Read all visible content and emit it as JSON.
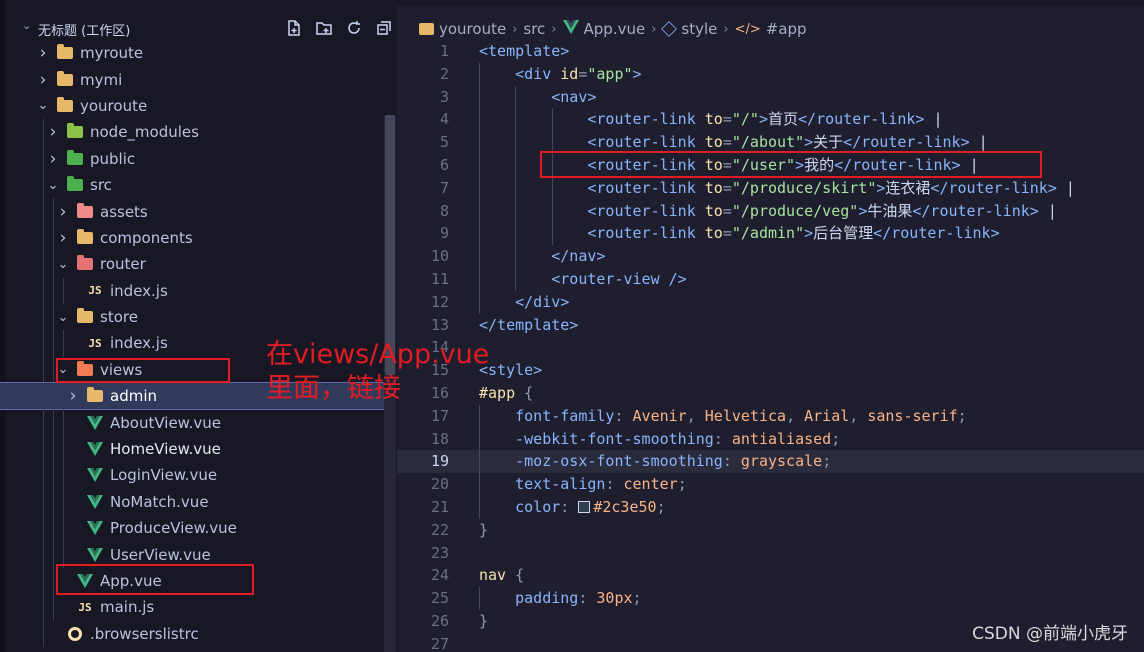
{
  "explorer": {
    "workspace_title": "无标题 (工作区)",
    "actions": [
      "new-file-icon",
      "new-folder-icon",
      "refresh-icon",
      "collapse-all-icon"
    ],
    "items": [
      {
        "label": "myroute",
        "kind": "folder",
        "depth": 0,
        "state": "collapsed",
        "icon_color": "#e8b86a"
      },
      {
        "label": "mymi",
        "kind": "folder",
        "depth": 0,
        "state": "collapsed",
        "icon_color": "#e8b86a"
      },
      {
        "label": "youroute",
        "kind": "folder",
        "depth": 0,
        "state": "expanded",
        "icon_color": "#e8b86a"
      },
      {
        "label": "node_modules",
        "kind": "folder",
        "depth": 1,
        "state": "collapsed",
        "icon_color": "#8bc34a"
      },
      {
        "label": "public",
        "kind": "folder",
        "depth": 1,
        "state": "collapsed",
        "icon_color": "#4caf50"
      },
      {
        "label": "src",
        "kind": "folder",
        "depth": 1,
        "state": "expanded",
        "icon_color": "#4caf50"
      },
      {
        "label": "assets",
        "kind": "folder",
        "depth": 2,
        "state": "collapsed",
        "icon_color": "#ef8a8a"
      },
      {
        "label": "components",
        "kind": "folder",
        "depth": 2,
        "state": "collapsed",
        "icon_color": "#e8b86a"
      },
      {
        "label": "router",
        "kind": "folder",
        "depth": 2,
        "state": "expanded",
        "icon_color": "#e57373"
      },
      {
        "label": "index.js",
        "kind": "js",
        "depth": 3
      },
      {
        "label": "store",
        "kind": "folder",
        "depth": 2,
        "state": "expanded",
        "icon_color": "#e8b86a"
      },
      {
        "label": "index.js",
        "kind": "js",
        "depth": 3
      },
      {
        "label": "views",
        "kind": "folder",
        "depth": 2,
        "state": "expanded",
        "icon_color": "#f57c52"
      },
      {
        "label": "admin",
        "kind": "folder",
        "depth": 3,
        "state": "collapsed",
        "icon_color": "#e8b86a",
        "selected": true
      },
      {
        "label": "AboutView.vue",
        "kind": "vue",
        "depth": 3
      },
      {
        "label": "HomeView.vue",
        "kind": "vue",
        "depth": 3,
        "bright": true
      },
      {
        "label": "LoginView.vue",
        "kind": "vue",
        "depth": 3
      },
      {
        "label": "NoMatch.vue",
        "kind": "vue",
        "depth": 3
      },
      {
        "label": "ProduceView.vue",
        "kind": "vue",
        "depth": 3
      },
      {
        "label": "UserView.vue",
        "kind": "vue",
        "depth": 3
      },
      {
        "label": "App.vue",
        "kind": "vue",
        "depth": 2
      },
      {
        "label": "main.js",
        "kind": "js",
        "depth": 2
      },
      {
        "label": ".browserslistrc",
        "kind": "browserslist",
        "depth": 1
      }
    ]
  },
  "breadcrumb": [
    "youroute",
    "src",
    "App.vue",
    "style",
    "#app"
  ],
  "editor": {
    "active_line": 19,
    "lines": [
      {
        "n": "1",
        "indent": 0,
        "tokens": [
          [
            "tag",
            "<template>"
          ]
        ]
      },
      {
        "n": "2",
        "indent": 1,
        "tokens": [
          [
            "tag",
            "<div "
          ],
          [
            "attr",
            "id"
          ],
          [
            "pun",
            "="
          ],
          [
            "str",
            "\"app\""
          ],
          [
            "tag",
            ">"
          ]
        ]
      },
      {
        "n": "3",
        "indent": 2,
        "tokens": [
          [
            "tag",
            "<nav>"
          ]
        ]
      },
      {
        "n": "4",
        "indent": 3,
        "tokens": [
          [
            "tag",
            "<router-link "
          ],
          [
            "attr",
            "to"
          ],
          [
            "pun",
            "="
          ],
          [
            "str",
            "\"/\""
          ],
          [
            "tag",
            ">"
          ],
          [
            "txt",
            "首页"
          ],
          [
            "tag",
            "</router-link>"
          ],
          [
            "txt",
            " |"
          ]
        ]
      },
      {
        "n": "5",
        "indent": 3,
        "tokens": [
          [
            "tag",
            "<router-link "
          ],
          [
            "attr",
            "to"
          ],
          [
            "pun",
            "="
          ],
          [
            "str",
            "\"/about\""
          ],
          [
            "tag",
            ">"
          ],
          [
            "txt",
            "关于"
          ],
          [
            "tag",
            "</router-link>"
          ],
          [
            "txt",
            " |"
          ]
        ]
      },
      {
        "n": "6",
        "indent": 3,
        "tokens": [
          [
            "tag",
            "<router-link "
          ],
          [
            "attr",
            "to"
          ],
          [
            "pun",
            "="
          ],
          [
            "str",
            "\"/user\""
          ],
          [
            "tag",
            ">"
          ],
          [
            "txt",
            "我的"
          ],
          [
            "tag",
            "</router-link>"
          ],
          [
            "txt",
            " |"
          ]
        ]
      },
      {
        "n": "7",
        "indent": 3,
        "tokens": [
          [
            "tag",
            "<router-link "
          ],
          [
            "attr",
            "to"
          ],
          [
            "pun",
            "="
          ],
          [
            "str",
            "\"/produce/skirt\""
          ],
          [
            "tag",
            ">"
          ],
          [
            "txt",
            "连衣裙"
          ],
          [
            "tag",
            "</router-link>"
          ],
          [
            "txt",
            " |"
          ]
        ]
      },
      {
        "n": "8",
        "indent": 3,
        "tokens": [
          [
            "tag",
            "<router-link "
          ],
          [
            "attr",
            "to"
          ],
          [
            "pun",
            "="
          ],
          [
            "str",
            "\"/produce/veg\""
          ],
          [
            "tag",
            ">"
          ],
          [
            "txt",
            "牛油果"
          ],
          [
            "tag",
            "</router-link>"
          ],
          [
            "txt",
            " |"
          ]
        ]
      },
      {
        "n": "9",
        "indent": 3,
        "tokens": [
          [
            "tag",
            "<router-link "
          ],
          [
            "attr",
            "to"
          ],
          [
            "pun",
            "="
          ],
          [
            "str",
            "\"/admin\""
          ],
          [
            "tag",
            ">"
          ],
          [
            "txt",
            "后台管理"
          ],
          [
            "tag",
            "</router-link>"
          ]
        ]
      },
      {
        "n": "10",
        "indent": 2,
        "tokens": [
          [
            "tag",
            "</nav>"
          ]
        ]
      },
      {
        "n": "11",
        "indent": 2,
        "tokens": [
          [
            "tag",
            "<router-view />"
          ]
        ]
      },
      {
        "n": "12",
        "indent": 1,
        "tokens": [
          [
            "tag",
            "</div>"
          ]
        ]
      },
      {
        "n": "13",
        "indent": 0,
        "tokens": [
          [
            "tag",
            "</template>"
          ]
        ]
      },
      {
        "n": "14",
        "indent": 0,
        "tokens": []
      },
      {
        "n": "15",
        "indent": 0,
        "tokens": [
          [
            "tag",
            "<style>"
          ]
        ]
      },
      {
        "n": "16",
        "indent": 0,
        "tokens": [
          [
            "sel",
            "#app"
          ],
          [
            "pun",
            " {"
          ]
        ]
      },
      {
        "n": "17",
        "indent": 1,
        "tokens": [
          [
            "prop",
            "font-family"
          ],
          [
            "pun",
            ": "
          ],
          [
            "val",
            "Avenir"
          ],
          [
            "pun",
            ", "
          ],
          [
            "val",
            "Helvetica"
          ],
          [
            "pun",
            ", "
          ],
          [
            "val",
            "Arial"
          ],
          [
            "pun",
            ", "
          ],
          [
            "val",
            "sans-serif"
          ],
          [
            "pun",
            ";"
          ]
        ]
      },
      {
        "n": "18",
        "indent": 1,
        "tokens": [
          [
            "prop",
            "-webkit-font-smoothing"
          ],
          [
            "pun",
            ": "
          ],
          [
            "val",
            "antialiased"
          ],
          [
            "pun",
            ";"
          ]
        ]
      },
      {
        "n": "19",
        "indent": 1,
        "tokens": [
          [
            "prop",
            "-moz-osx-font-smoothing"
          ],
          [
            "pun",
            ": "
          ],
          [
            "val",
            "grayscale"
          ],
          [
            "pun",
            ";"
          ]
        ]
      },
      {
        "n": "20",
        "indent": 1,
        "tokens": [
          [
            "prop",
            "text-align"
          ],
          [
            "pun",
            ": "
          ],
          [
            "val",
            "center"
          ],
          [
            "pun",
            ";"
          ]
        ]
      },
      {
        "n": "21",
        "indent": 1,
        "tokens": [
          [
            "prop",
            "color"
          ],
          [
            "pun",
            ": "
          ],
          [
            "swatch",
            "#2c3e50"
          ],
          [
            "val",
            "#2c3e50"
          ],
          [
            "pun",
            ";"
          ]
        ]
      },
      {
        "n": "22",
        "indent": 0,
        "tokens": [
          [
            "pun",
            "}"
          ]
        ]
      },
      {
        "n": "23",
        "indent": 0,
        "tokens": []
      },
      {
        "n": "24",
        "indent": 0,
        "tokens": [
          [
            "sel",
            "nav"
          ],
          [
            "pun",
            " {"
          ]
        ]
      },
      {
        "n": "25",
        "indent": 1,
        "tokens": [
          [
            "prop",
            "padding"
          ],
          [
            "pun",
            ": "
          ],
          [
            "val",
            "30px"
          ],
          [
            "pun",
            ";"
          ]
        ]
      },
      {
        "n": "26",
        "indent": 0,
        "tokens": [
          [
            "pun",
            "}"
          ]
        ]
      },
      {
        "n": "27",
        "indent": 0,
        "tokens": []
      }
    ]
  },
  "annotation": {
    "line1": "在views/App.vue",
    "line2": "里面，链接",
    "color": "#e31b23"
  },
  "watermark": "CSDN @前端小虎牙"
}
